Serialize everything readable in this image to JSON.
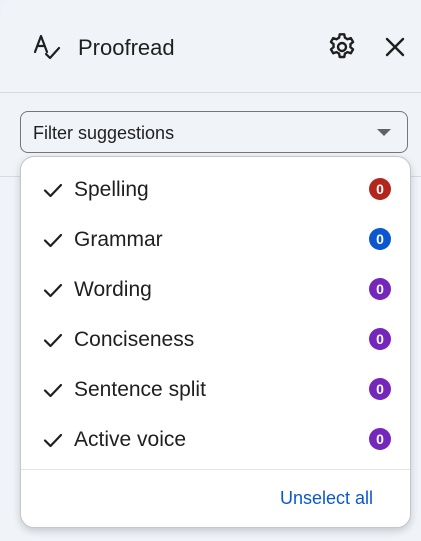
{
  "header": {
    "title": "Proofread",
    "icon": "spellcheck-icon"
  },
  "filter": {
    "label": "Filter suggestions"
  },
  "options": [
    {
      "label": "Spelling",
      "count": "0",
      "color": "#b3261e",
      "checked": true
    },
    {
      "label": "Grammar",
      "count": "0",
      "color": "#0b57d0",
      "checked": true
    },
    {
      "label": "Wording",
      "count": "0",
      "color": "#7627bb",
      "checked": true
    },
    {
      "label": "Conciseness",
      "count": "0",
      "color": "#7627bb",
      "checked": true
    },
    {
      "label": "Sentence split",
      "count": "0",
      "color": "#7627bb",
      "checked": true
    },
    {
      "label": "Active voice",
      "count": "0",
      "color": "#7627bb",
      "checked": true
    }
  ],
  "footer": {
    "unselect_label": "Unselect all"
  },
  "colors": {
    "panel_bg": "#f0f4f9",
    "link": "#0b57d0"
  }
}
